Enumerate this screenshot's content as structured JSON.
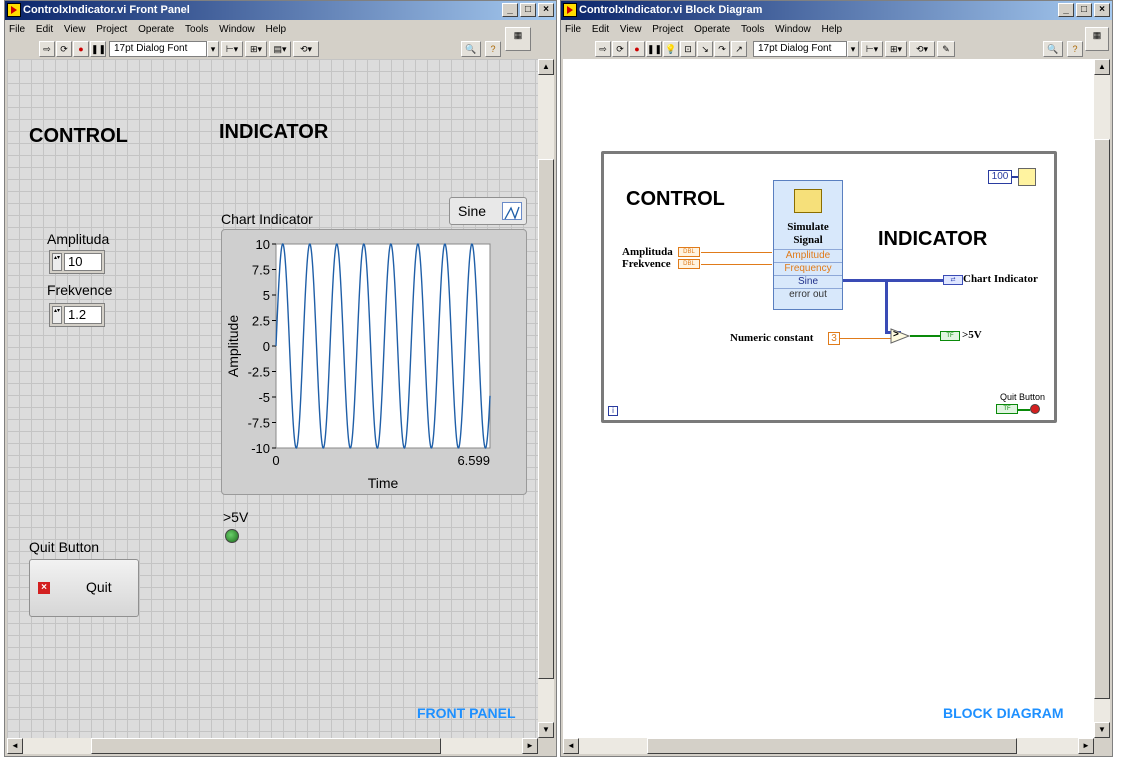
{
  "front_panel": {
    "title": "ControlxIndicator.vi Front Panel",
    "menu": [
      "File",
      "Edit",
      "View",
      "Project",
      "Operate",
      "Tools",
      "Window",
      "Help"
    ],
    "font_selector": "17pt Dialog Font",
    "heading_control": "CONTROL",
    "heading_indicator": "INDICATOR",
    "amplitude": {
      "label": "Amplituda",
      "value": "10"
    },
    "frequency": {
      "label": "Frekvence",
      "value": "1.2"
    },
    "chart": {
      "label": "Chart Indicator",
      "legend": "Sine",
      "ylabel": "Amplitude",
      "xlabel": "Time",
      "x_min_label": "0",
      "x_max_label": "6.599",
      "y_ticks": [
        "10",
        "7.5",
        "5",
        "2.5",
        "0",
        "-2.5",
        "-5",
        "-7.5",
        "-10"
      ]
    },
    "led_label": ">5V",
    "quit": {
      "caption": "Quit Button",
      "text": "Quit"
    },
    "corner_tag": "FRONT PANEL"
  },
  "block_diagram": {
    "title": "ControlxIndicator.vi Block Diagram",
    "menu": [
      "File",
      "Edit",
      "View",
      "Project",
      "Operate",
      "Tools",
      "Window",
      "Help"
    ],
    "font_selector": "17pt Dialog Font",
    "heading_control": "CONTROL",
    "heading_indicator": "INDICATOR",
    "amplitude_terminal": "Amplituda",
    "frequency_terminal": "Frekvence",
    "dbl_tag": "DBL",
    "express_vi": {
      "title": "Simulate Signal",
      "inputs": [
        "Amplitude",
        "Frequency"
      ],
      "outputs": [
        "Sine",
        "error out"
      ]
    },
    "chart_terminal": "Chart Indicator",
    "numeric_constant_label": "Numeric constant",
    "numeric_constant_value": "3",
    "compare_symbol": ">",
    "tf_tag": "TF",
    "led_terminal": ">5V",
    "wait_constant": "100",
    "quit_terminal": "Quit Button",
    "iteration_label": "i",
    "corner_tag": "BLOCK DIAGRAM"
  },
  "chart_data": {
    "type": "line",
    "title": "",
    "xlabel": "Time",
    "ylabel": "Amplitude",
    "xlim": [
      0,
      6.599
    ],
    "ylim": [
      -10,
      10
    ],
    "series": [
      {
        "name": "Sine",
        "amplitude": 10,
        "frequency": 1.2,
        "color": "#1f5fa8"
      }
    ]
  }
}
